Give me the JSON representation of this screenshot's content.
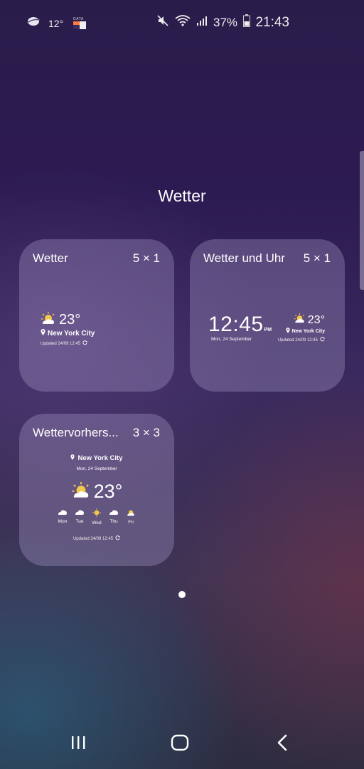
{
  "status_bar": {
    "temperature": "12°",
    "data_label": "DATA",
    "battery_percent": "37%",
    "time": "21:43",
    "icons": [
      "weather-cloud-icon",
      "data-indicator-icon",
      "mute-icon",
      "wifi-icon",
      "signal-icon",
      "battery-icon"
    ]
  },
  "page_title": "Wetter",
  "widgets": [
    {
      "title": "Wetter",
      "size": "5 × 1",
      "preview": {
        "temperature": "23°",
        "location": "New York City",
        "updated": "Updated 24/09 12:45"
      }
    },
    {
      "title": "Wetter und Uhr",
      "size": "5 × 1",
      "preview": {
        "clock": "12:45",
        "ampm": "PM",
        "date": "Mon, 24 September",
        "temperature": "23°",
        "location": "New York City",
        "updated": "Updated 24/09 12:45"
      }
    },
    {
      "title": "Wettervorhers...",
      "size": "3 × 3",
      "preview": {
        "location": "New York City",
        "date": "Mon, 24 September",
        "temperature": "23°",
        "forecast": [
          {
            "day": "Mon",
            "icon": "cloud-icon"
          },
          {
            "day": "Tue",
            "icon": "cloud-icon"
          },
          {
            "day": "Wed",
            "icon": "sun-icon"
          },
          {
            "day": "Thu",
            "icon": "cloud-icon"
          },
          {
            "day": "Fri",
            "icon": "partly-sunny-icon"
          }
        ],
        "updated": "Updated 24/09 12:45"
      }
    }
  ],
  "pagination": {
    "current_page": 1,
    "total_pages": 1
  },
  "nav_bar": {
    "buttons": [
      "recents-icon",
      "home-icon",
      "back-icon"
    ]
  },
  "colors": {
    "sun": "#f5c84a",
    "card": "#aa9bc8"
  }
}
